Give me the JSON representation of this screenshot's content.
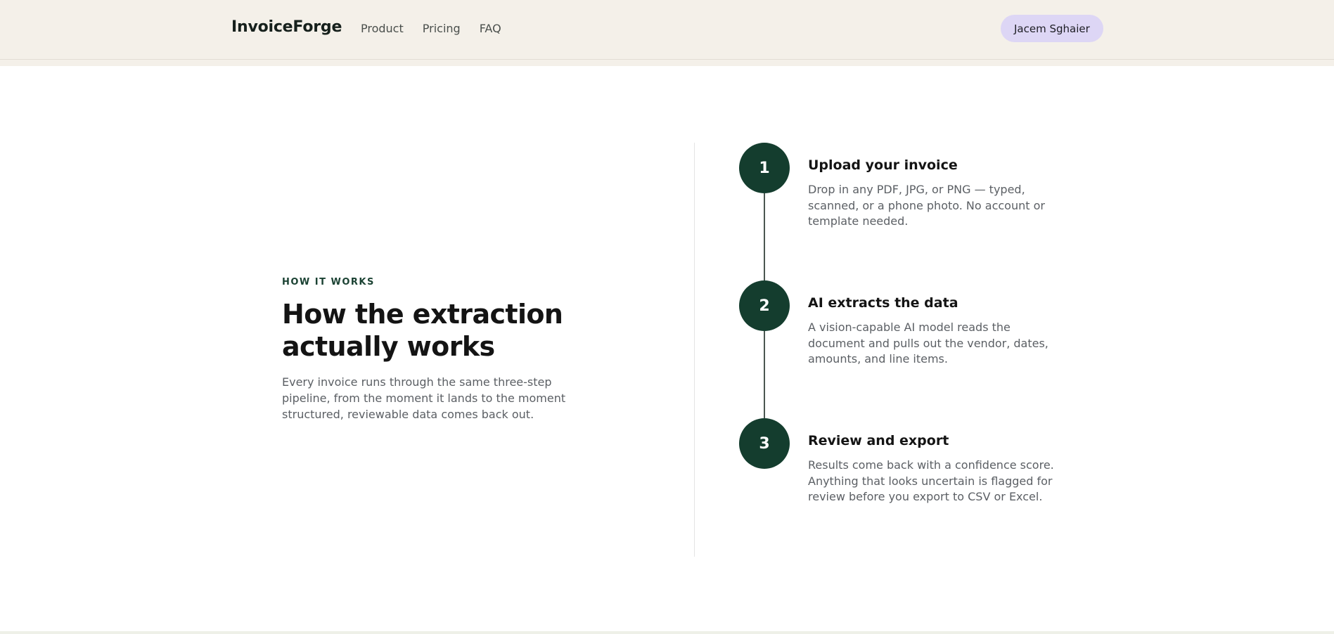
{
  "header": {
    "brand": "InvoiceForge",
    "nav": [
      "Product",
      "Pricing",
      "FAQ"
    ],
    "user_name": "Jacem Sghaier"
  },
  "section": {
    "eyebrow": "HOW IT WORKS",
    "headline": "How the extraction actually works",
    "intro": "Every invoice runs through the same three-step pipeline, from the moment it lands to the moment structured, reviewable data comes back out."
  },
  "steps": [
    {
      "number": "1",
      "title": "Upload your invoice",
      "description": "Drop in any PDF, JPG, or PNG — typed, scanned, or a phone photo. No account or template needed."
    },
    {
      "number": "2",
      "title": "AI extracts the data",
      "description": "A vision-capable AI model reads the document and pulls out the vendor, dates, amounts, and line items."
    },
    {
      "number": "3",
      "title": "Review and export",
      "description": "Results come back with a confidence score. Anything that looks uncertain is flagged for review before you export to CSV or Excel."
    }
  ],
  "colors": {
    "header_bg": "#f4f0e9",
    "accent_dark_green": "#143d2e",
    "user_pill_bg": "#ddd6f5"
  }
}
